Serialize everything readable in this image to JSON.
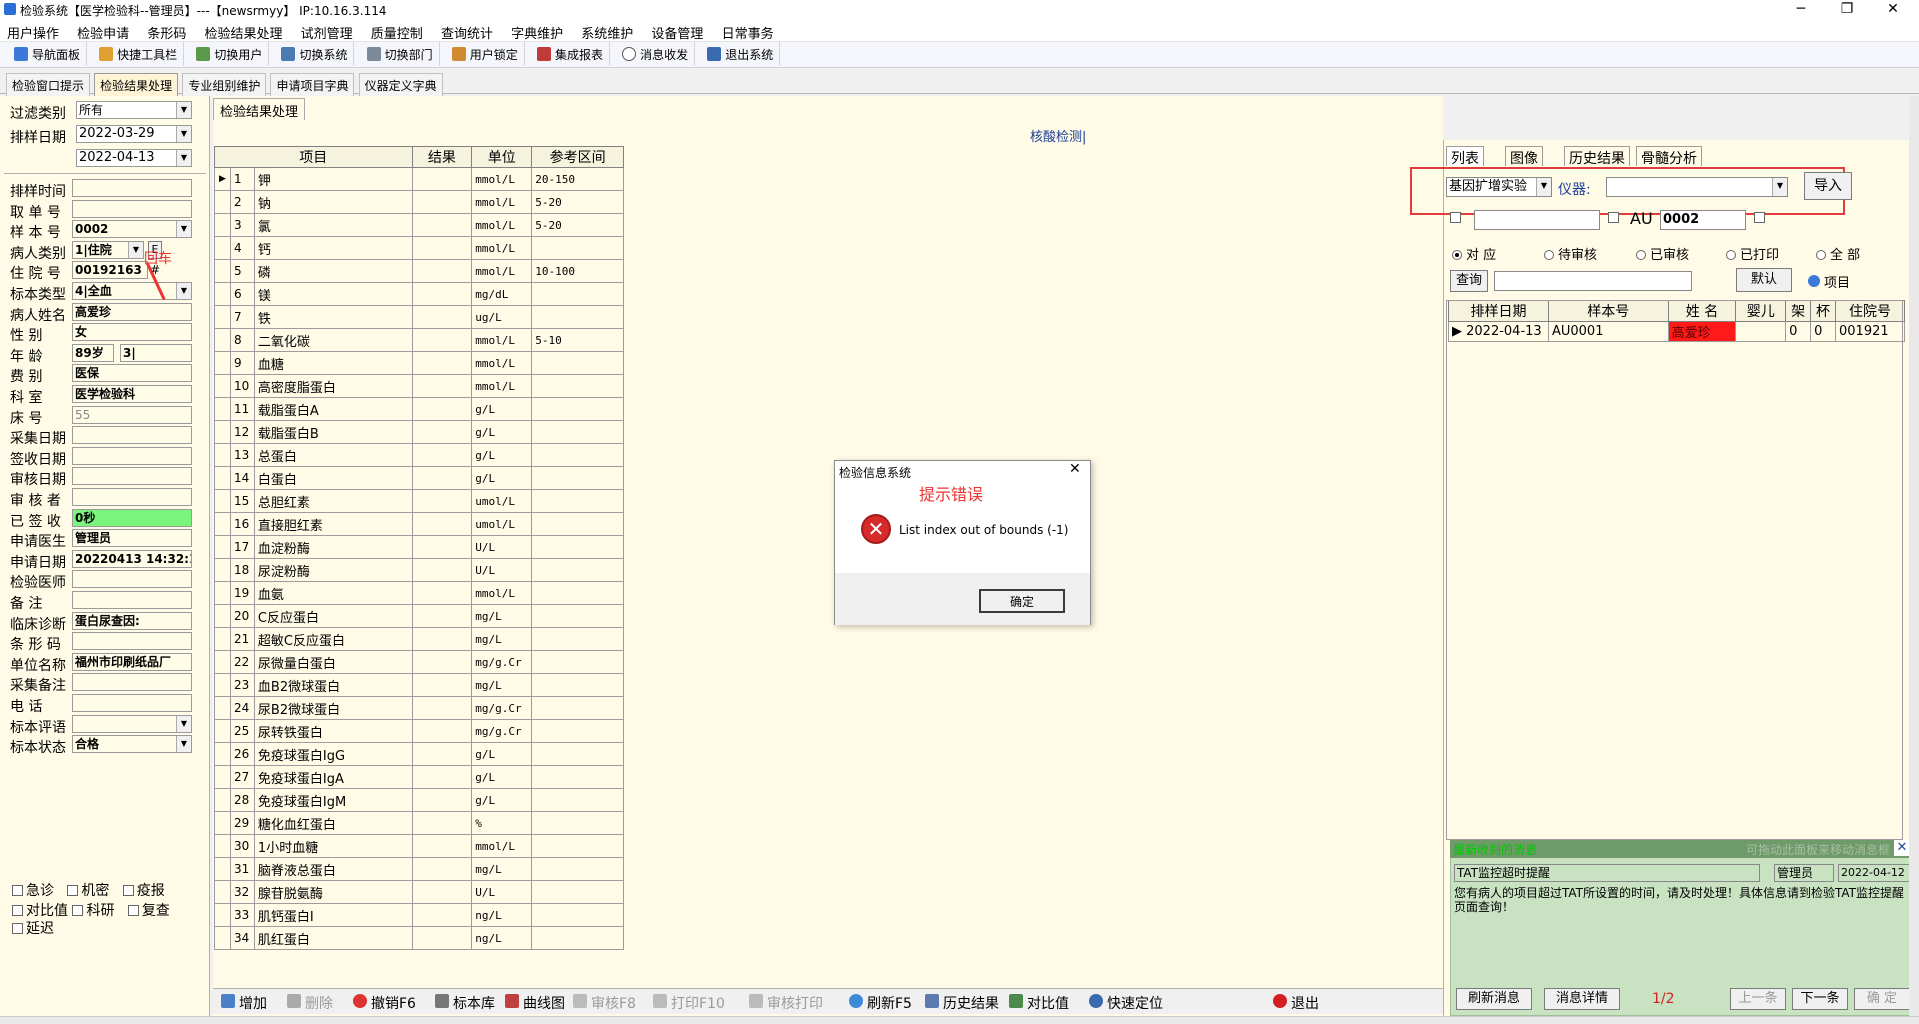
{
  "window": {
    "title": "检验系统【医学检验科--管理员】---【newsrmyy】 IP:10.16.3.114",
    "min": "─",
    "max": "❐",
    "close": "✕"
  },
  "menu": [
    "用户操作",
    "检验申请",
    "条形码",
    "检验结果处理",
    "试剂管理",
    "质量控制",
    "查询统计",
    "字典维护",
    "系统维护",
    "设备管理",
    "日常事务"
  ],
  "toolbar": [
    "导航面板",
    "快捷工具栏",
    "切换用户",
    "切换系统",
    "切换部门",
    "用户锁定",
    "集成报表",
    "消息收发",
    "退出系统"
  ],
  "wintabs": [
    "检验窗口提示",
    "检验结果处理",
    "专业组别维护",
    "申请项目字典",
    "仪器定义字典"
  ],
  "left": {
    "filter_label": "过滤类别",
    "filter_value": "所有",
    "date_label": "排样日期",
    "date_from": "2022-03-29",
    "date_to": "2022-04-13",
    "fields": [
      {
        "label": "排样时间",
        "value": ""
      },
      {
        "label": "取 单 号",
        "value": ""
      },
      {
        "label": "样 本 号",
        "value": "0002"
      },
      {
        "label": "病人类别",
        "value": "1|住院"
      },
      {
        "label": "住 院 号",
        "value": "00192163"
      },
      {
        "label": "标本类型",
        "value": "4|全血"
      },
      {
        "label": "病人姓名",
        "value": "高爱珍"
      },
      {
        "label": "性    别",
        "value": "女"
      },
      {
        "label": "年    龄",
        "value": "89岁"
      },
      {
        "label": "费    别",
        "value": "医保"
      },
      {
        "label": "科    室",
        "value": "医学检验科"
      },
      {
        "label": "床    号",
        "value": "55"
      },
      {
        "label": "采集日期",
        "value": ""
      },
      {
        "label": "签收日期",
        "value": ""
      },
      {
        "label": "审核日期",
        "value": ""
      },
      {
        "label": "审 核 者",
        "value": ""
      },
      {
        "label": "已 签 收",
        "value": "0秒"
      },
      {
        "label": "申请医生",
        "value": "管理员"
      },
      {
        "label": "申请日期",
        "value": "20220413 14:32:1"
      },
      {
        "label": "检验医师",
        "value": ""
      },
      {
        "label": "备    注",
        "value": ""
      },
      {
        "label": "临床诊断",
        "value": "蛋白尿查因:"
      },
      {
        "label": "条 形 码",
        "value": ""
      },
      {
        "label": "单位名称",
        "value": "福州市印刷纸品厂"
      },
      {
        "label": "采集备注",
        "value": ""
      },
      {
        "label": "电    话",
        "value": ""
      },
      {
        "label": "标本评语",
        "value": ""
      },
      {
        "label": "标本状态",
        "value": "合格"
      }
    ],
    "age_extra": "3|",
    "e_button": "E",
    "hash_button": "#",
    "annotation": "回车",
    "checkboxes": [
      [
        "急诊",
        "机密",
        "疫报"
      ],
      [
        "对比值",
        "科研",
        "复查"
      ],
      [
        "延迟"
      ]
    ]
  },
  "center": {
    "tab": "检验结果处理",
    "title": "核酸检测|",
    "columns": [
      "项目",
      "结果",
      "单位",
      "参考区间"
    ],
    "rows": [
      {
        "no": "1",
        "name": "钾",
        "result": "",
        "unit": "mmol/L",
        "ref": "20-150"
      },
      {
        "no": "2",
        "name": "钠",
        "result": "",
        "unit": "mmol/L",
        "ref": "5-20"
      },
      {
        "no": "3",
        "name": "氯",
        "result": "",
        "unit": "mmol/L",
        "ref": "5-20"
      },
      {
        "no": "4",
        "name": "钙",
        "result": "",
        "unit": "mmol/L",
        "ref": ""
      },
      {
        "no": "5",
        "name": "磷",
        "result": "",
        "unit": "mmol/L",
        "ref": "10-100"
      },
      {
        "no": "6",
        "name": "镁",
        "result": "",
        "unit": "mg/dL",
        "ref": ""
      },
      {
        "no": "7",
        "name": "铁",
        "result": "",
        "unit": "ug/L",
        "ref": ""
      },
      {
        "no": "8",
        "name": "二氧化碳",
        "result": "",
        "unit": "mmol/L",
        "ref": "5-10"
      },
      {
        "no": "9",
        "name": "血糖",
        "result": "",
        "unit": "mmol/L",
        "ref": ""
      },
      {
        "no": "10",
        "name": "高密度脂蛋白",
        "result": "",
        "unit": "mmol/L",
        "ref": ""
      },
      {
        "no": "11",
        "name": "载脂蛋白A",
        "result": "",
        "unit": "g/L",
        "ref": ""
      },
      {
        "no": "12",
        "name": "载脂蛋白B",
        "result": "",
        "unit": "g/L",
        "ref": ""
      },
      {
        "no": "13",
        "name": "总蛋白",
        "result": "",
        "unit": "g/L",
        "ref": ""
      },
      {
        "no": "14",
        "name": "白蛋白",
        "result": "",
        "unit": "g/L",
        "ref": ""
      },
      {
        "no": "15",
        "name": "总胆红素",
        "result": "",
        "unit": "umol/L",
        "ref": ""
      },
      {
        "no": "16",
        "name": "直接胆红素",
        "result": "",
        "unit": "umol/L",
        "ref": ""
      },
      {
        "no": "17",
        "name": "血淀粉酶",
        "result": "",
        "unit": "U/L",
        "ref": ""
      },
      {
        "no": "18",
        "name": "尿淀粉酶",
        "result": "",
        "unit": "U/L",
        "ref": ""
      },
      {
        "no": "19",
        "name": "血氨",
        "result": "",
        "unit": "mmol/L",
        "ref": ""
      },
      {
        "no": "20",
        "name": "C反应蛋白",
        "result": "",
        "unit": "mg/L",
        "ref": ""
      },
      {
        "no": "21",
        "name": "超敏C反应蛋白",
        "result": "",
        "unit": "mg/L",
        "ref": ""
      },
      {
        "no": "22",
        "name": "尿微量白蛋白",
        "result": "",
        "unit": "mg/g.Cr",
        "ref": ""
      },
      {
        "no": "23",
        "name": "血B2微球蛋白",
        "result": "",
        "unit": "mg/L",
        "ref": ""
      },
      {
        "no": "24",
        "name": "尿B2微球蛋白",
        "result": "",
        "unit": "mg/g.Cr",
        "ref": ""
      },
      {
        "no": "25",
        "name": "尿转铁蛋白",
        "result": "",
        "unit": "mg/g.Cr",
        "ref": ""
      },
      {
        "no": "26",
        "name": "免疫球蛋白IgG",
        "result": "",
        "unit": "g/L",
        "ref": ""
      },
      {
        "no": "27",
        "name": "免疫球蛋白IgA",
        "result": "",
        "unit": "g/L",
        "ref": ""
      },
      {
        "no": "28",
        "name": "免疫球蛋白IgM",
        "result": "",
        "unit": "g/L",
        "ref": ""
      },
      {
        "no": "29",
        "name": "糖化血红蛋白",
        "result": "",
        "unit": "%",
        "ref": ""
      },
      {
        "no": "30",
        "name": "1小时血糖",
        "result": "",
        "unit": "mmol/L",
        "ref": ""
      },
      {
        "no": "31",
        "name": "脑脊液总蛋白",
        "result": "",
        "unit": "mg/L",
        "ref": ""
      },
      {
        "no": "32",
        "name": "腺苷脱氨酶",
        "result": "",
        "unit": "U/L",
        "ref": ""
      },
      {
        "no": "33",
        "name": "肌钙蛋白I",
        "result": "",
        "unit": "ng/L",
        "ref": ""
      },
      {
        "no": "34",
        "name": "肌红蛋白",
        "result": "",
        "unit": "ng/L",
        "ref": ""
      }
    ],
    "bottom_buttons": [
      "增加",
      "删除",
      "撤销F6",
      "标本库",
      "曲线图",
      "审核F8",
      "打印F10",
      "审核打印",
      "刷新F5",
      "历史结果",
      "对比值",
      "快速定位",
      "退出"
    ]
  },
  "right": {
    "tabs": [
      "列表",
      "图像",
      "历史结果",
      "骨髓分析"
    ],
    "lab_select": "基因扩增实验",
    "instrument_label": "仪器:",
    "instrument_value": "",
    "import_button": "导入",
    "au_label": "AU",
    "au_value": "0002",
    "radios": [
      "对 应",
      "待审核",
      "已审核",
      "已打印",
      "全 部"
    ],
    "query_button": "查询",
    "default_button": "默认",
    "item_label": "项目",
    "columns": [
      "排样日期",
      "样本号",
      "姓 名",
      "婴儿",
      "架",
      "杯",
      "住院号"
    ],
    "rows": [
      {
        "date": "2022-04-13",
        "sample": "AU0001",
        "name": "高爱珍",
        "baby": "",
        "rack": "0",
        "cup": "0",
        "inpatient": "001921"
      }
    ],
    "name_highlight": "#ff1a1a"
  },
  "messages": {
    "header_left": "最新收到的消息",
    "header_right": "可拖动此面板来移动消息框",
    "subject": "TAT监控超时提醒",
    "sender": "管理员",
    "date": "2022-04-12",
    "body": "您有病人的项目超过TAT所设置的时间，请及时处理！具体信息请到检验TAT监控提醒页面查询！",
    "refresh_button": "刷新消息",
    "detail_button": "消息详情",
    "page": "1/2",
    "prev_button": "上一条",
    "next_button": "下一条",
    "ok_button": "确 定"
  },
  "dialog": {
    "title": "检验信息系统",
    "annotation": "提示错误",
    "message": "List index out of bounds (-1)",
    "ok": "确定"
  }
}
